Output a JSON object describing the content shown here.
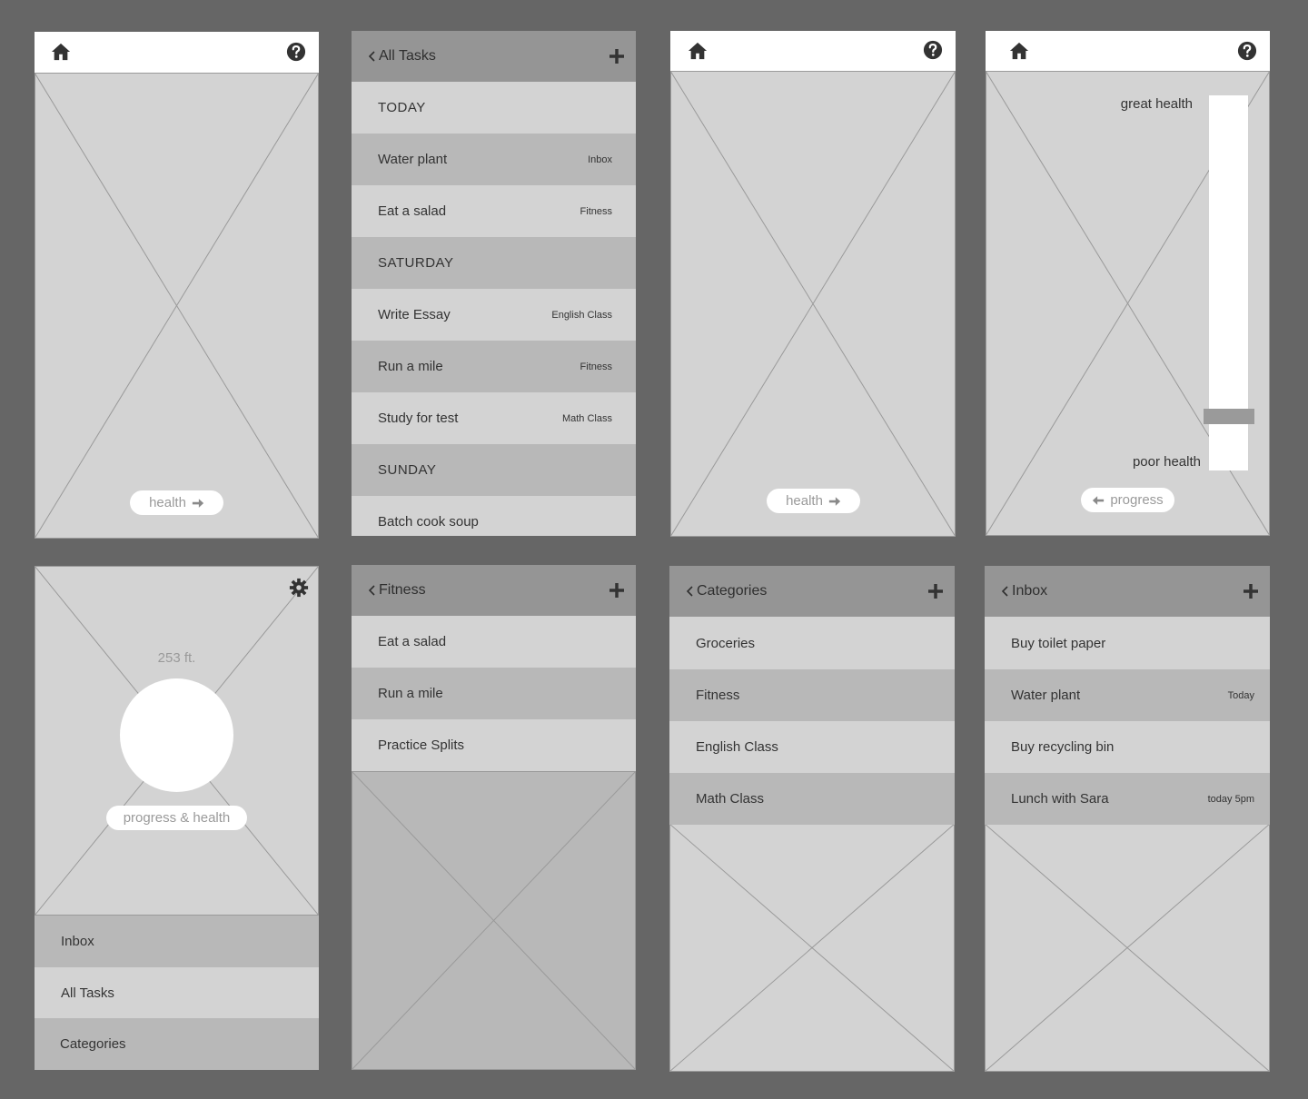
{
  "colors": {
    "background": "#666666",
    "screen": "#d3d3d3",
    "row_dark": "#b8b8b8",
    "header": "#959595",
    "white": "#ffffff",
    "icon": "#333333"
  },
  "home_screen": {
    "nav_button": "health"
  },
  "all_tasks": {
    "back_label": "All Tasks",
    "rows": [
      {
        "label": "TODAY",
        "tag": ""
      },
      {
        "label": "Water plant",
        "tag": "Inbox"
      },
      {
        "label": "Eat a salad",
        "tag": "Fitness"
      },
      {
        "label": "SATURDAY",
        "tag": ""
      },
      {
        "label": "Write Essay",
        "tag": "English Class"
      },
      {
        "label": "Run a mile",
        "tag": "Fitness"
      },
      {
        "label": "Study for test",
        "tag": "Math Class"
      },
      {
        "label": "SUNDAY",
        "tag": ""
      },
      {
        "label": "Batch cook soup",
        "tag": ""
      }
    ]
  },
  "home_screen_2": {
    "nav_button": "health"
  },
  "health_screen": {
    "top_label": "great health",
    "bottom_label": "poor health",
    "nav_button": "progress",
    "health_level": 0.13
  },
  "progress_screen": {
    "distance": "253 ft.",
    "caption": "progress & health",
    "menu": [
      "Inbox",
      "All Tasks",
      "Categories"
    ]
  },
  "fitness": {
    "back_label": "Fitness",
    "rows": [
      "Eat a salad",
      "Run a mile",
      "Practice Splits"
    ]
  },
  "categories": {
    "back_label": "Categories",
    "rows": [
      "Groceries",
      "Fitness",
      "English Class",
      "Math Class"
    ]
  },
  "inbox": {
    "back_label": "Inbox",
    "rows": [
      {
        "label": "Buy toilet paper",
        "tag": ""
      },
      {
        "label": "Water plant",
        "tag": "Today"
      },
      {
        "label": "Buy recycling bin",
        "tag": ""
      },
      {
        "label": "Lunch with Sara",
        "tag": "today 5pm"
      }
    ]
  }
}
